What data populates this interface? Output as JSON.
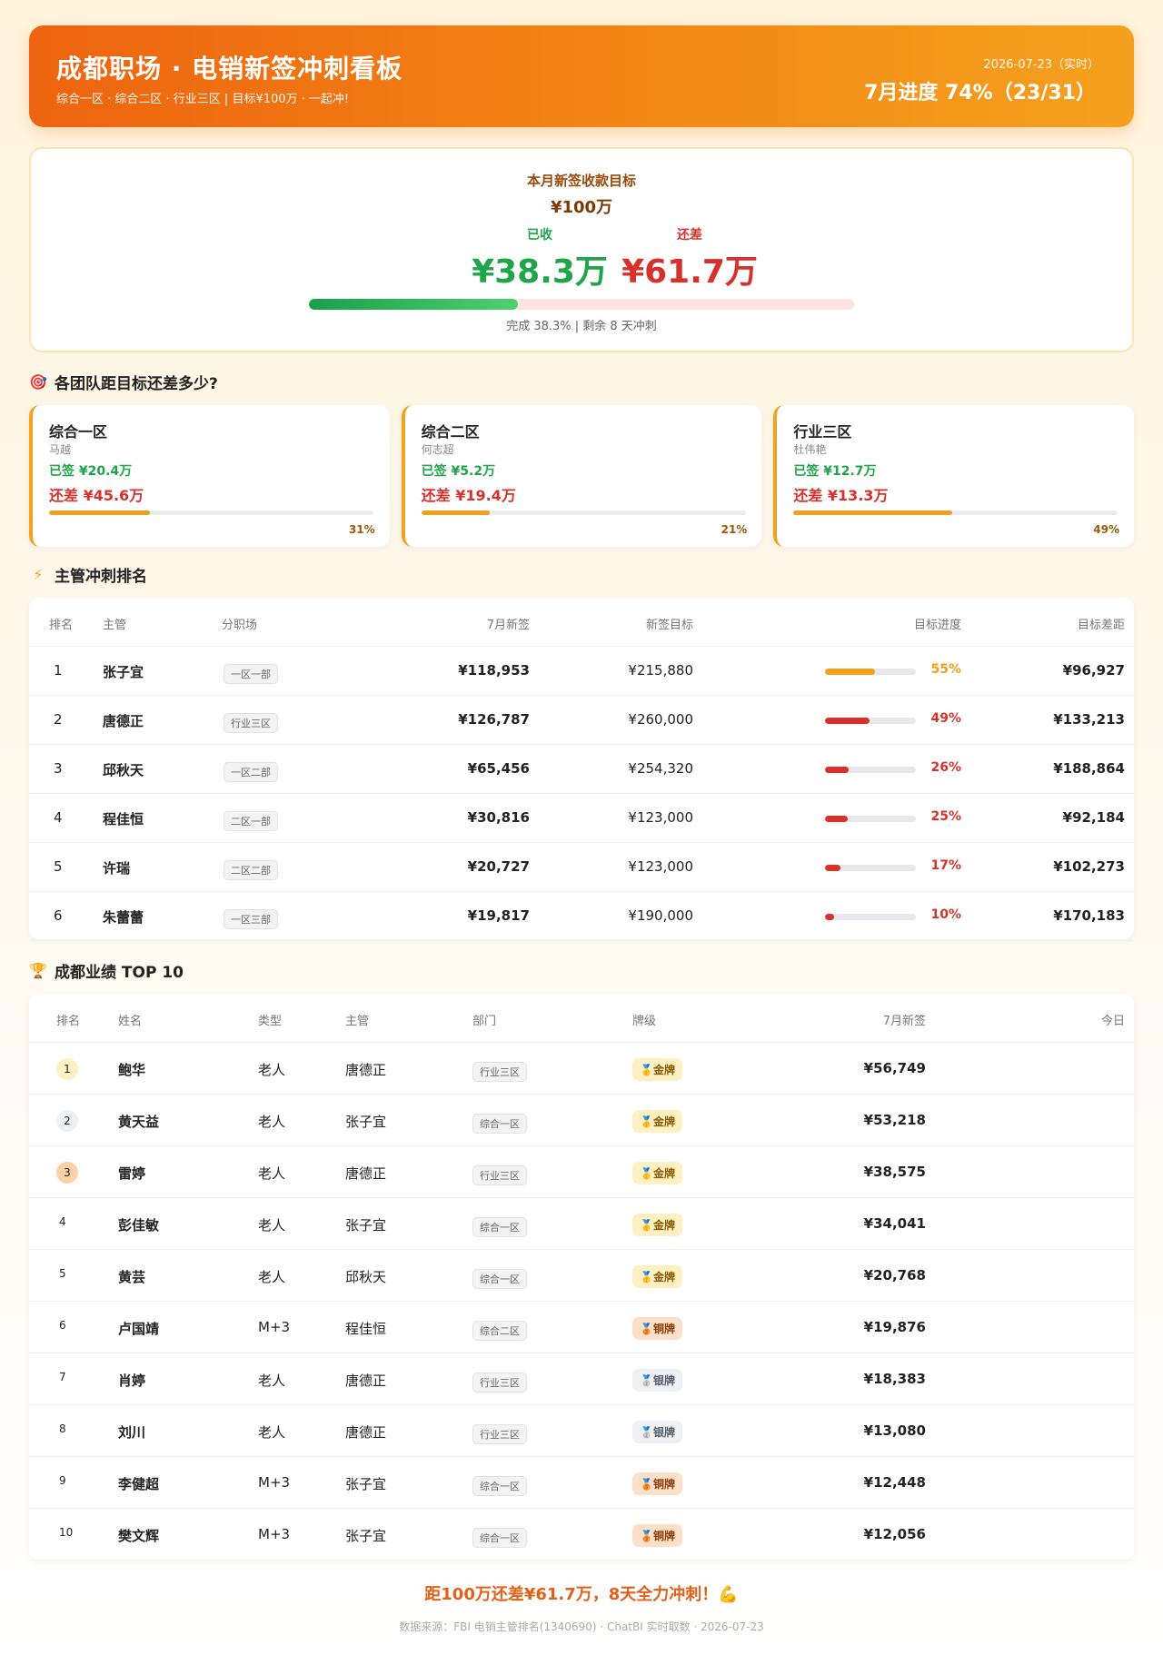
{
  "header": {
    "title": "成都职场 · 电销新签冲刺看板",
    "subtitle": "综合一区 · 综合二区 · 行业三区   |   目标¥100万 · 一起冲!",
    "date": "2026-07-23（实时）",
    "progress": "7月进度 74%（23/31）"
  },
  "goal": {
    "label": "本月新签收款目标",
    "total": "¥100万",
    "done_caption": "已收",
    "done_value": "¥38.3万",
    "left_caption": "还差",
    "left_value": "¥61.7万",
    "completion_fraction": 0.383,
    "note": "完成 38.3%   |   剩余 8 天冲刺"
  },
  "teams_section": {
    "icon": "target-icon",
    "title": "各团队距目标还差多少?"
  },
  "teams": [
    {
      "name": "综合一区",
      "manager": "马越",
      "signed": "已签 ¥20.4万",
      "gap": "还差 ¥45.6万",
      "pct": "31%",
      "fraction": 0.31
    },
    {
      "name": "综合二区",
      "manager": "何志超",
      "signed": "已签 ¥5.2万",
      "gap": "还差 ¥19.4万",
      "pct": "21%",
      "fraction": 0.21
    },
    {
      "name": "行业三区",
      "manager": "杜伟艳",
      "signed": "已签 ¥12.7万",
      "gap": "还差 ¥13.3万",
      "pct": "49%",
      "fraction": 0.49
    }
  ],
  "managers_section": {
    "icon": "lightning-icon",
    "title": "主管冲刺排名"
  },
  "managers_table": {
    "headers": {
      "rank": "排名",
      "name": "主管",
      "branch": "分职场",
      "signed": "7月新签",
      "target": "新签目标",
      "progress": "目标进度",
      "gap": "目标差距"
    },
    "rows": [
      {
        "rank": "1",
        "name": "张子宜",
        "branch": "一区一部",
        "signed": "¥118,953",
        "target": "¥215,880",
        "pct": "55%",
        "fraction": 0.55,
        "gap": "¥96,927"
      },
      {
        "rank": "2",
        "name": "唐德正",
        "branch": "行业三区",
        "signed": "¥126,787",
        "target": "¥260,000",
        "pct": "49%",
        "fraction": 0.49,
        "gap": "¥133,213"
      },
      {
        "rank": "3",
        "name": "邱秋天",
        "branch": "一区二部",
        "signed": "¥65,456",
        "target": "¥254,320",
        "pct": "26%",
        "fraction": 0.26,
        "gap": "¥188,864"
      },
      {
        "rank": "4",
        "name": "程佳恒",
        "branch": "二区一部",
        "signed": "¥30,816",
        "target": "¥123,000",
        "pct": "25%",
        "fraction": 0.25,
        "gap": "¥92,184"
      },
      {
        "rank": "5",
        "name": "许瑞",
        "branch": "二区二部",
        "signed": "¥20,727",
        "target": "¥123,000",
        "pct": "17%",
        "fraction": 0.17,
        "gap": "¥102,273"
      },
      {
        "rank": "6",
        "name": "朱蕾蕾",
        "branch": "一区三部",
        "signed": "¥19,817",
        "target": "¥190,000",
        "pct": "10%",
        "fraction": 0.1,
        "gap": "¥170,183"
      }
    ]
  },
  "top_section": {
    "icon": "trophy-icon",
    "title": "成都业绩 TOP 10"
  },
  "top_table": {
    "headers": {
      "rank": "排名",
      "name": "姓名",
      "type": "类型",
      "manager": "主管",
      "dept": "部门",
      "medal": "牌级",
      "signed": "7月新签",
      "today": "今日"
    },
    "rows": [
      {
        "rank": "1",
        "name": "鲍华",
        "type": "老人",
        "manager": "唐德正",
        "dept": "行业三区",
        "medal": "🥇金牌",
        "medal_kind": "gold",
        "signed": "¥56,749"
      },
      {
        "rank": "2",
        "name": "黄天益",
        "type": "老人",
        "manager": "张子宜",
        "dept": "综合一区",
        "medal": "🥇金牌",
        "medal_kind": "gold",
        "signed": "¥53,218"
      },
      {
        "rank": "3",
        "name": "雷婷",
        "type": "老人",
        "manager": "唐德正",
        "dept": "行业三区",
        "medal": "🥇金牌",
        "medal_kind": "gold",
        "signed": "¥38,575"
      },
      {
        "rank": "4",
        "name": "彭佳敏",
        "type": "老人",
        "manager": "张子宜",
        "dept": "综合一区",
        "medal": "🥇金牌",
        "medal_kind": "gold",
        "signed": "¥34,041"
      },
      {
        "rank": "5",
        "name": "黄芸",
        "type": "老人",
        "manager": "邱秋天",
        "dept": "综合一区",
        "medal": "🥇金牌",
        "medal_kind": "gold",
        "signed": "¥20,768"
      },
      {
        "rank": "6",
        "name": "卢国靖",
        "type": "M+3",
        "manager": "程佳恒",
        "dept": "综合二区",
        "medal": "🥉铜牌",
        "medal_kind": "bronze",
        "signed": "¥19,876"
      },
      {
        "rank": "7",
        "name": "肖婷",
        "type": "老人",
        "manager": "唐德正",
        "dept": "行业三区",
        "medal": "🥈银牌",
        "medal_kind": "silver",
        "signed": "¥18,383"
      },
      {
        "rank": "8",
        "name": "刘川",
        "type": "老人",
        "manager": "唐德正",
        "dept": "行业三区",
        "medal": "🥈银牌",
        "medal_kind": "silver",
        "signed": "¥13,080"
      },
      {
        "rank": "9",
        "name": "李健超",
        "type": "M+3",
        "manager": "张子宜",
        "dept": "综合一区",
        "medal": "🥉铜牌",
        "medal_kind": "bronze",
        "signed": "¥12,448"
      },
      {
        "rank": "10",
        "name": "樊文辉",
        "type": "M+3",
        "manager": "张子宜",
        "dept": "综合一区",
        "medal": "🥉铜牌",
        "medal_kind": "bronze",
        "signed": "¥12,056"
      }
    ]
  },
  "footer": {
    "main": "距100万还差¥61.7万，8天全力冲刺！💪",
    "source": "数据来源：FBI 电销主管排名(1340690) · ChatBI 实时取数 · 2026-07-23"
  },
  "colors": {
    "accent": "#ee6410",
    "done_green": "#1fa54a",
    "gap_red": "#d8302a",
    "progress_orange": "#f0a01c"
  }
}
